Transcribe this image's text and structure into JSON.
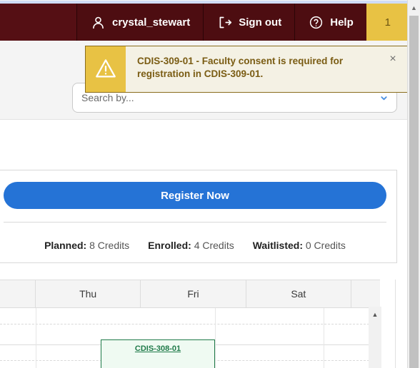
{
  "header": {
    "user": {
      "label": "crystal_stewart",
      "icon": "user-icon"
    },
    "signout": {
      "label": "Sign out",
      "icon": "sign-out-icon"
    },
    "help": {
      "label": "Help",
      "icon": "help-circle-icon"
    },
    "notification_badge": "1",
    "colors": {
      "bar": "#4d0d11",
      "badge": "#e8c244"
    }
  },
  "alert": {
    "icon": "warning-triangle-icon",
    "message": "CDIS-309-01 - Faculty consent is required for registration in CDIS-309-01.",
    "close_label": "×",
    "colors": {
      "panel": "#e8c244",
      "body": "#f4f1e4",
      "text": "#7a5c13",
      "border": "#8a6d1c"
    }
  },
  "search": {
    "value": "",
    "placeholder": "Search by...",
    "caret_icon": "chevron-down-icon"
  },
  "register": {
    "button_label": "Register Now",
    "color": "#2573d6"
  },
  "credits": {
    "items": [
      {
        "label": "Planned:",
        "value": "8 Credits"
      },
      {
        "label": "Enrolled:",
        "value": "4 Credits"
      },
      {
        "label": "Waitlisted:",
        "value": "0 Credits"
      }
    ]
  },
  "calendar": {
    "day_headers": [
      "",
      "Thu",
      "Fri",
      "Sat",
      ""
    ],
    "events": [
      {
        "course": "CDIS-308-01",
        "day": "Thu",
        "color": "#1f7a49",
        "background": "#effaf2"
      }
    ],
    "scroll_up_icon": "triangle-up-icon"
  },
  "window": {
    "scroll_up_icon": "triangle-up-icon"
  }
}
